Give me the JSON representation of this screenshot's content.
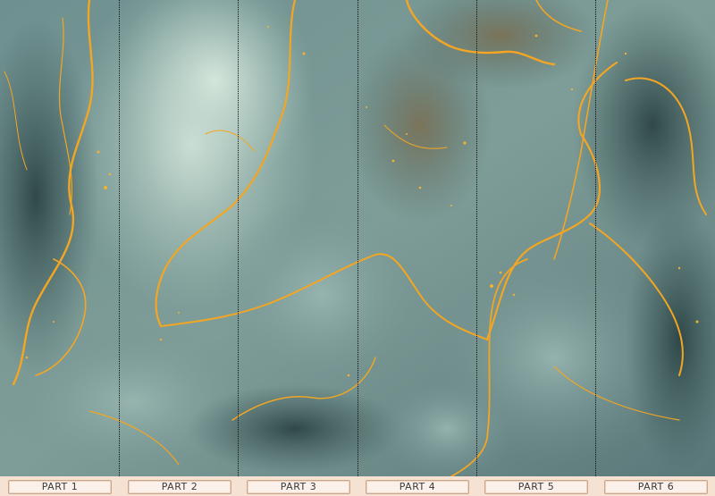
{
  "panels": [
    {
      "label": "PART 1"
    },
    {
      "label": "PART 2"
    },
    {
      "label": "PART 3"
    },
    {
      "label": "PART 4"
    },
    {
      "label": "PART 5"
    },
    {
      "label": "PART 6"
    }
  ],
  "colors": {
    "marble_base": "#5f7f80",
    "marble_light": "#b9d3cb",
    "marble_dark": "#2f4a4b",
    "gold_vein": "#f2a623",
    "label_bar": "#f6e2d2"
  }
}
